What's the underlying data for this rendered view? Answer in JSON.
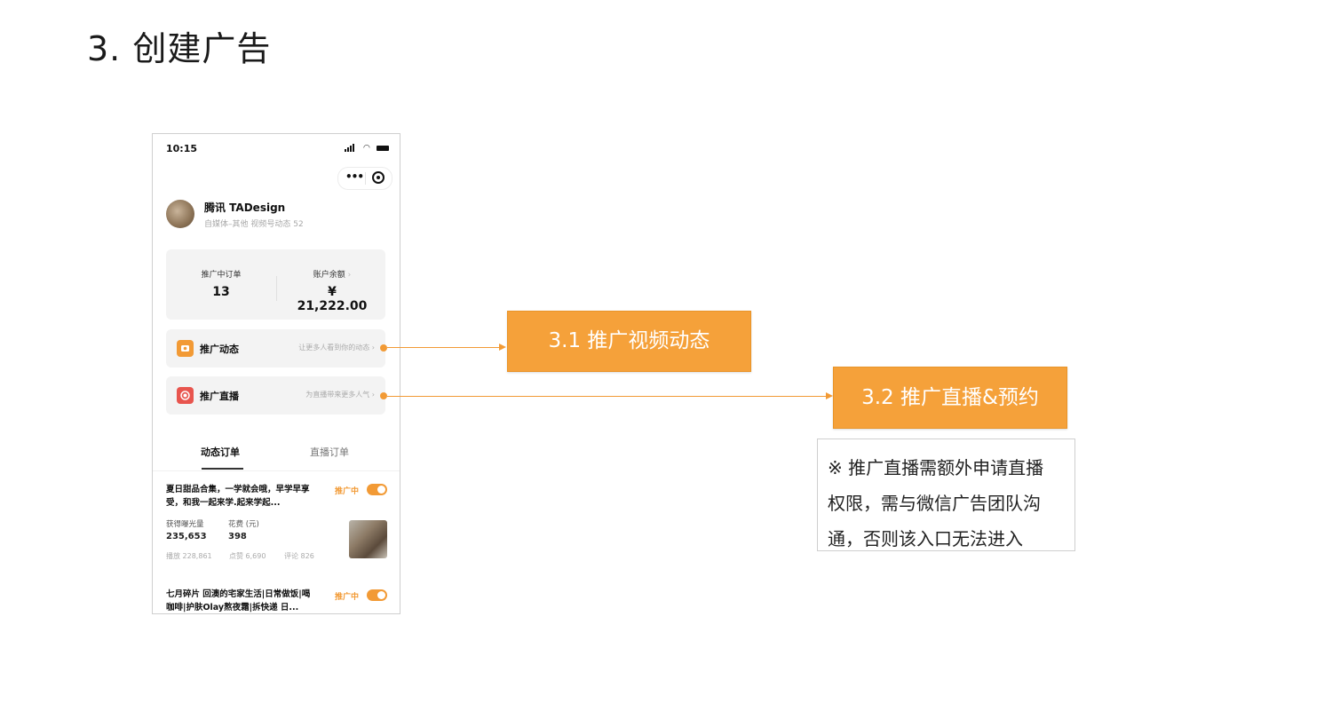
{
  "slide": {
    "title": "3. 创建广告"
  },
  "phone": {
    "status_time": "10:15",
    "profile": {
      "name": "腾讯 TADesign",
      "subtitle": "自媒体–其他  视频号动态 52"
    },
    "stats": {
      "orders_label": "推广中订单",
      "orders_value": "13",
      "balance_label": "账户余额",
      "balance_value": "¥ 21,222.00"
    },
    "promo_rows": [
      {
        "label": "推广动态",
        "hint": "让更多人看到你的动态",
        "icon": "camera-icon",
        "color": "#f29a35"
      },
      {
        "label": "推广直播",
        "hint": "为直播带来更多人气",
        "icon": "live-icon",
        "color": "#e8554e"
      }
    ],
    "tabs": {
      "active": "动态订单",
      "inactive": "直播订单"
    },
    "orders": [
      {
        "title": "夏日甜品合集，一学就会哦，早学早享受，和我一起来学.起来学起...",
        "status": "推广中",
        "metric1_label": "获得曝光量",
        "metric1_value": "235,653",
        "metric2_label": "花费 (元)",
        "metric2_value": "398",
        "plays": "播放 228,861",
        "likes": "点赞 6,690",
        "comments": "评论 826"
      },
      {
        "title": "七月碎片 回澳的宅家生活|日常做饭|喝咖啡|护肤Olay熬夜霜|拆快递 日...",
        "status": "推广中"
      }
    ]
  },
  "callouts": {
    "video": "3.1 推广视频动态",
    "live": "3.2 推广直播&预约",
    "note_lines": [
      "※ 推广直播需额外申请直播",
      "权限，需与微信广告团队沟",
      "通，否则该入口无法进入"
    ]
  },
  "colors": {
    "accent": "#f5a13a",
    "live_red": "#e8554e"
  }
}
